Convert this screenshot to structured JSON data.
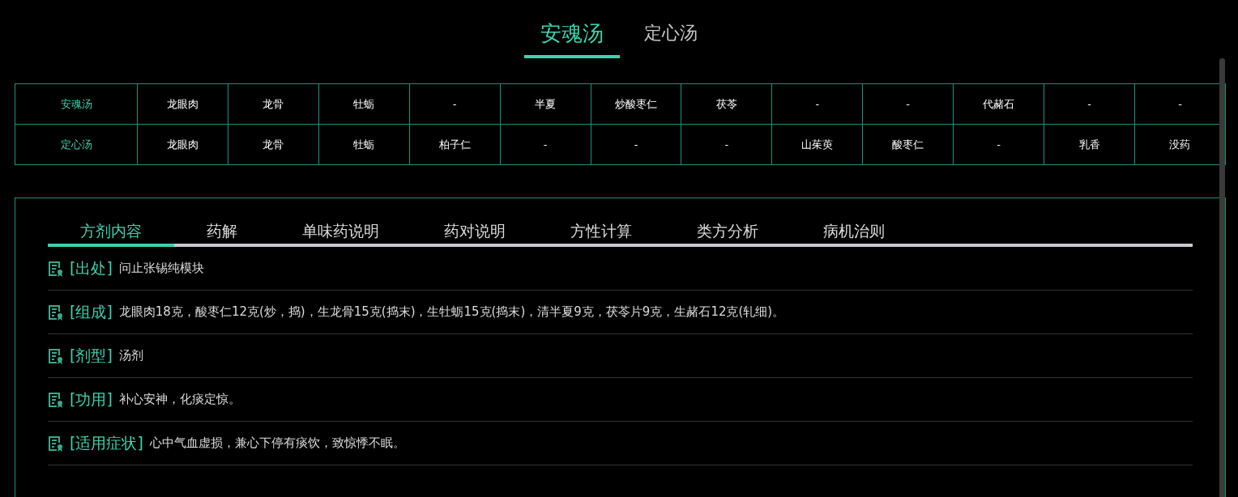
{
  "formula_tabs": [
    {
      "label": "安魂汤",
      "selected": true
    },
    {
      "label": "定心汤",
      "selected": false
    }
  ],
  "comparison_table": {
    "rows": [
      {
        "name": "安魂汤",
        "cells": [
          "龙眼肉",
          "龙骨",
          "牡蛎",
          "-",
          "半夏",
          "炒酸枣仁",
          "茯苓",
          "-",
          "-",
          "代赭石",
          "-",
          "-"
        ]
      },
      {
        "name": "定心汤",
        "cells": [
          "龙眼肉",
          "龙骨",
          "牡蛎",
          "柏子仁",
          "-",
          "-",
          "-",
          "山茱萸",
          "酸枣仁",
          "-",
          "乳香",
          "没药"
        ]
      }
    ]
  },
  "detail_tabs": [
    {
      "label": "方剂内容",
      "selected": true
    },
    {
      "label": "药解",
      "selected": false
    },
    {
      "label": "单味药说明",
      "selected": false
    },
    {
      "label": "药对说明",
      "selected": false
    },
    {
      "label": "方性计算",
      "selected": false
    },
    {
      "label": "类方分析",
      "selected": false
    },
    {
      "label": "病机治则",
      "selected": false
    }
  ],
  "details": [
    {
      "label": "[出处]",
      "value": "问止张锡纯模块"
    },
    {
      "label": "[组成]",
      "value": "龙眼肉18克，酸枣仁12克(炒，捣)，生龙骨15克(捣末)，生牡蛎15克(捣末)，清半夏9克，茯苓片9克，生赭石12克(轧细)。"
    },
    {
      "label": "[剂型]",
      "value": "汤剂"
    },
    {
      "label": "[功用]",
      "value": "补心安神，化痰定惊。"
    },
    {
      "label": "[适用症状]",
      "value": "心中气血虚损，兼心下停有痰饮，致惊悸不眠。"
    }
  ]
}
